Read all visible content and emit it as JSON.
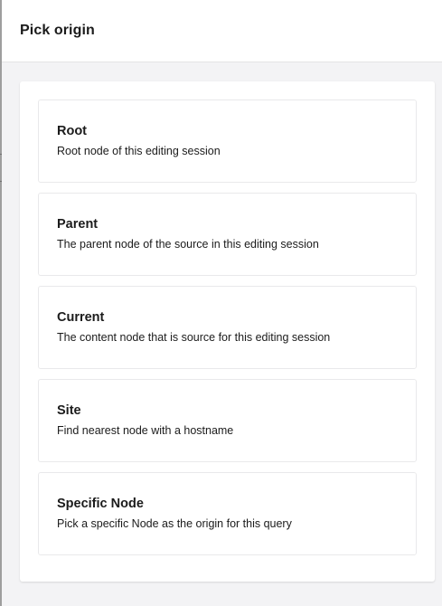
{
  "header": {
    "title": "Pick origin"
  },
  "options": [
    {
      "name": "Root",
      "description": "Root node of this editing session"
    },
    {
      "name": "Parent",
      "description": "The parent node of the source in this editing session"
    },
    {
      "name": "Current",
      "description": "The content node that is source for this editing session"
    },
    {
      "name": "Site",
      "description": "Find nearest node with a hostname"
    },
    {
      "name": "Specific Node",
      "description": "Pick a specific Node as the origin for this query"
    }
  ],
  "colors": {
    "background": "#f3f3f5",
    "panel": "#ffffff",
    "card_border": "#e9e9eb",
    "text": "#1b1b1b"
  }
}
